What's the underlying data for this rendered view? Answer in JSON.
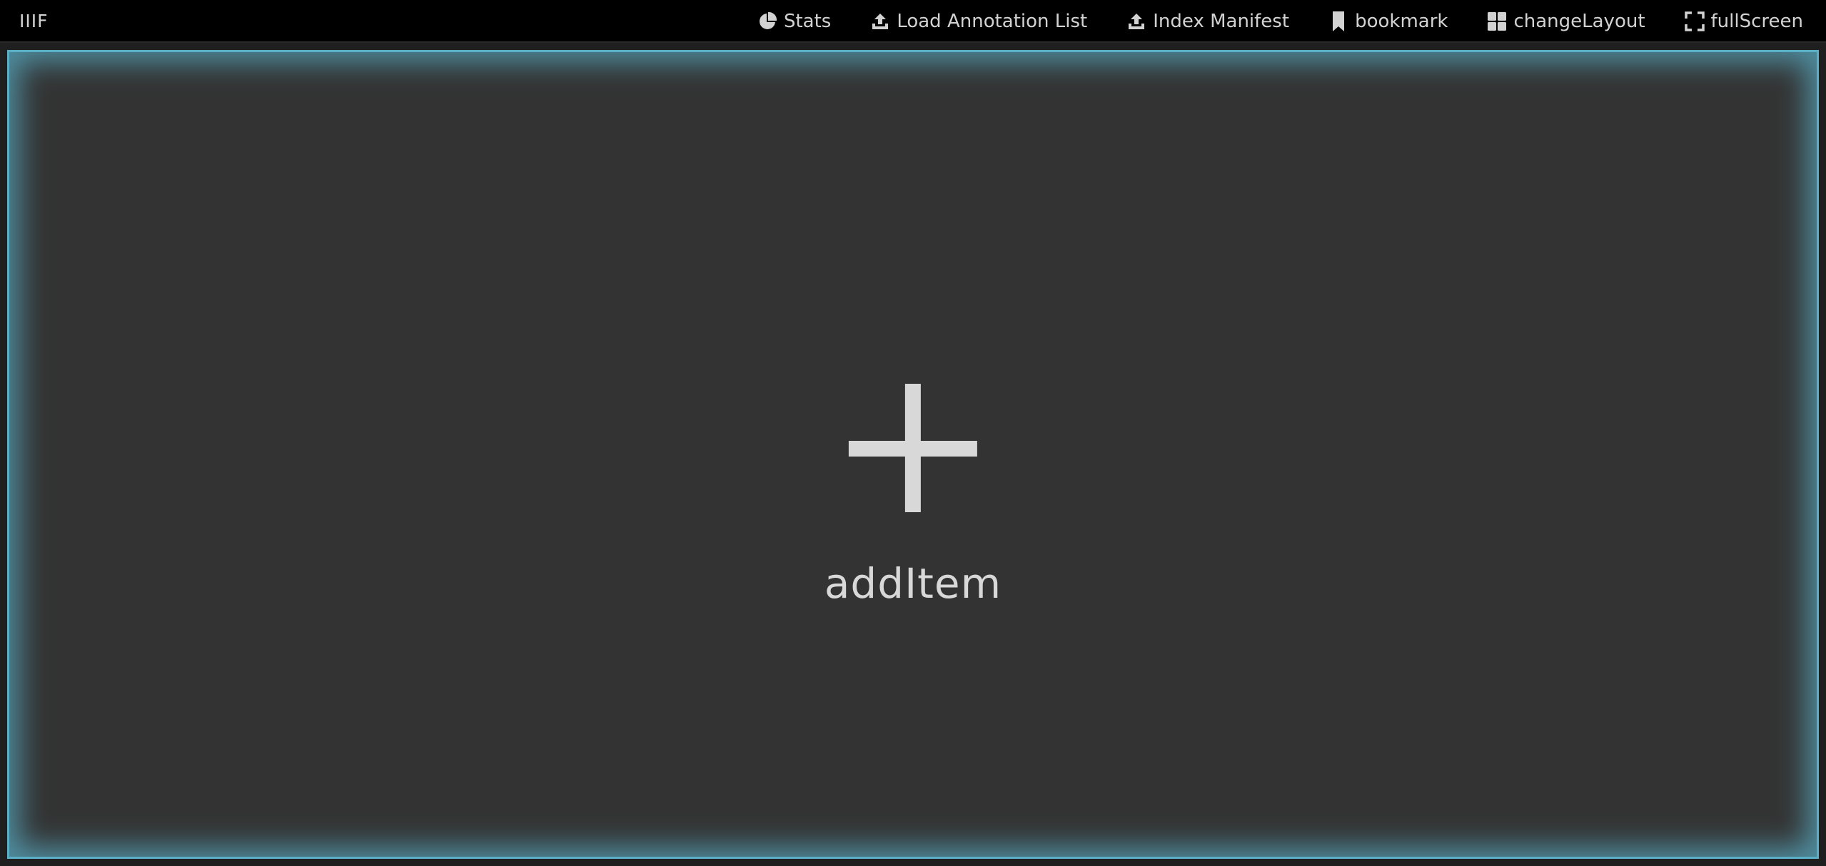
{
  "app": {
    "brand": "IIIF"
  },
  "toolbar": {
    "items": [
      {
        "label": "Stats",
        "icon": "pie-chart-icon"
      },
      {
        "label": "Load Annotation List",
        "icon": "upload-icon"
      },
      {
        "label": "Index Manifest",
        "icon": "upload-icon"
      },
      {
        "label": "bookmark",
        "icon": "bookmark-icon"
      },
      {
        "label": "changeLayout",
        "icon": "grid-icon"
      },
      {
        "label": "fullScreen",
        "icon": "fullscreen-icon"
      }
    ]
  },
  "workspace": {
    "add_icon": "plus-icon",
    "add_label": "addItem"
  },
  "colors": {
    "topbar": "#000000",
    "workspace": "#333333",
    "highlight": "#5aaec6",
    "text": "#d2d2d2"
  }
}
